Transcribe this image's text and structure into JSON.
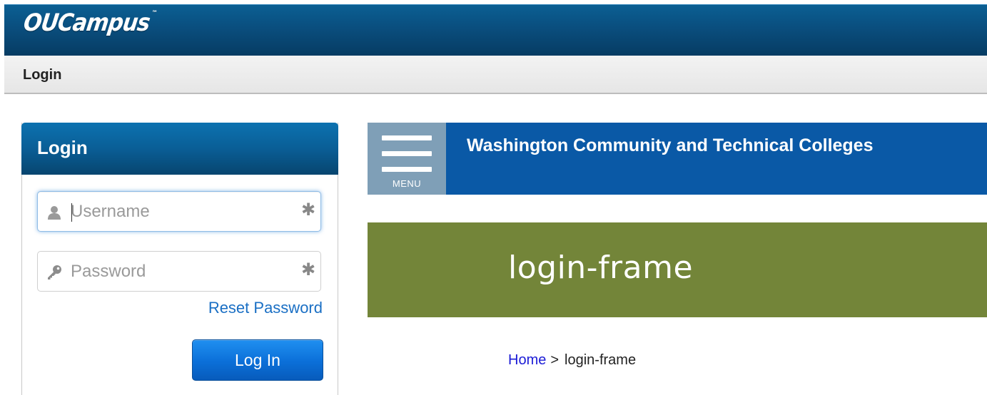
{
  "app": {
    "logo_text": "OUCampus",
    "logo_tm": "™"
  },
  "page_title": "Login",
  "login_panel": {
    "header": "Login",
    "username": {
      "placeholder": "Username",
      "value": ""
    },
    "password": {
      "placeholder": "Password",
      "value": ""
    },
    "reset_label": "Reset Password",
    "login_label": "Log In"
  },
  "site_frame": {
    "menu_label": "MENU",
    "site_title": "Washington Community and Technical Colleges",
    "hero_title": "login-frame",
    "breadcrumb": {
      "home": "Home",
      "separator": ">",
      "current": "login-frame"
    }
  },
  "icons": {
    "username": "user-icon",
    "password": "key-icon",
    "required": "asterisk-icon",
    "menu": "hamburger-menu-icon"
  },
  "colors": {
    "brand_bar": "#0a4e7e",
    "login_header": "#0a5e96",
    "login_button": "#0b6fd8",
    "link": "#1a6fc4",
    "site_header": "#0a59a6",
    "menu_button": "#7f9fb7",
    "hero_band": "#738539",
    "breadcrumb_link": "#1b1bd6"
  }
}
